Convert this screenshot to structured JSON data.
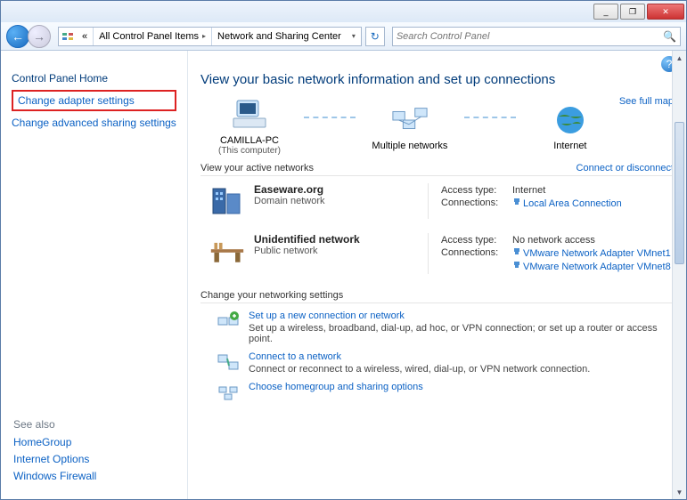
{
  "window": {
    "min": "_",
    "max": "❐",
    "close": "✕"
  },
  "breadcrumb": {
    "seg1": "All Control Panel Items",
    "seg2": "Network and Sharing Center"
  },
  "search": {
    "placeholder": "Search Control Panel"
  },
  "sidebar": {
    "home": "Control Panel Home",
    "adapter": "Change adapter settings",
    "advanced": "Change advanced sharing settings"
  },
  "seealso": {
    "hdr": "See also",
    "homegroup": "HomeGroup",
    "inet": "Internet Options",
    "firewall": "Windows Firewall"
  },
  "heading": "View your basic network information and set up connections",
  "map": {
    "pc": "CAMILLA-PC",
    "pcsub": "(This computer)",
    "net": "Multiple networks",
    "inet": "Internet",
    "full": "See full map"
  },
  "active": {
    "hdr": "View your active networks",
    "link": "Connect or disconnect",
    "n1": {
      "name": "Easeware.org",
      "sub": "Domain network",
      "access": "Internet",
      "conn": "Local Area Connection"
    },
    "n2": {
      "name": "Unidentified network",
      "sub": "Public network",
      "access": "No network access",
      "conn1": "VMware Network Adapter VMnet1",
      "conn2": "VMware Network Adapter VMnet8"
    },
    "k_access": "Access type:",
    "k_conn": "Connections:"
  },
  "change": {
    "hdr": "Change your networking settings",
    "a1": {
      "t": "Set up a new connection or network",
      "d": "Set up a wireless, broadband, dial-up, ad hoc, or VPN connection; or set up a router or access point."
    },
    "a2": {
      "t": "Connect to a network",
      "d": "Connect or reconnect to a wireless, wired, dial-up, or VPN network connection."
    },
    "a3": {
      "t": "Choose homegroup and sharing options"
    }
  }
}
